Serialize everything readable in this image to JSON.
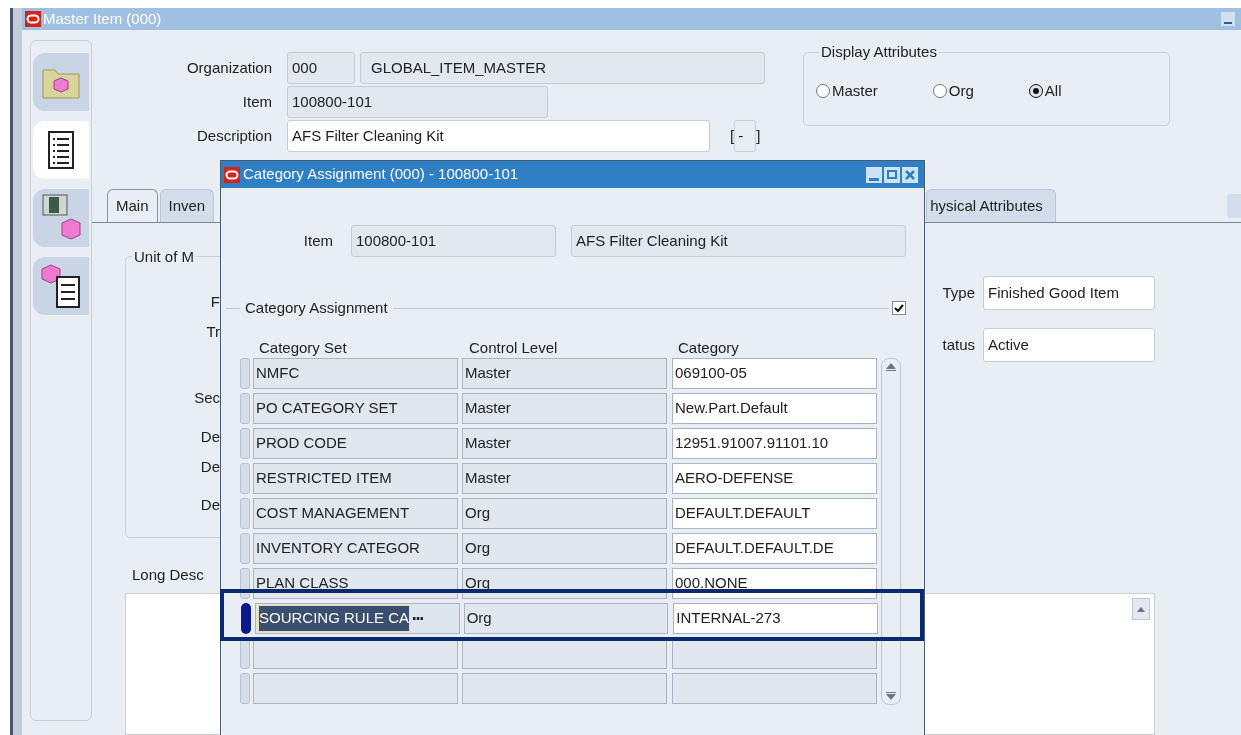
{
  "master_window": {
    "title": "Master Item (000)"
  },
  "header": {
    "organization": {
      "label": "Organization",
      "code": "000",
      "name": "GLOBAL_ITEM_MASTER"
    },
    "item": {
      "label": "Item",
      "value": "100800-101"
    },
    "description": {
      "label": "Description",
      "value": "AFS Filter Cleaning Kit"
    },
    "flexfield": {
      "open": "[",
      "value": "-",
      "close": "]"
    }
  },
  "display_attributes": {
    "title": "Display Attributes",
    "options": [
      {
        "label": "Master",
        "selected": false
      },
      {
        "label": "Org",
        "selected": false
      },
      {
        "label": "All",
        "selected": true
      }
    ]
  },
  "tabs": [
    {
      "label": "Main",
      "selected": true
    },
    {
      "label": "Inven",
      "selected": false
    },
    {
      "label": "hysical Attributes",
      "selected": false
    }
  ],
  "main_tab": {
    "group_title": "Unit of M",
    "labels": [
      "F",
      "Tr",
      "Sec",
      "De",
      "De",
      "De"
    ],
    "fields": [
      {
        "label": "Type",
        "value": "Finished Good Item"
      },
      {
        "label": "tatus",
        "value": "Active"
      }
    ],
    "long_description_label": "Long Desc"
  },
  "dialog": {
    "title": "Category Assignment (000) - 100800-101",
    "item": {
      "label": "Item",
      "value": "100800-101",
      "description": "AFS Filter Cleaning Kit"
    },
    "group_title": "Category Assignment",
    "group_checked": true,
    "columns": [
      "Category Set",
      "Control Level",
      "Category"
    ],
    "rows": [
      {
        "category_set": "NMFC",
        "control_level": "Master",
        "category": "069100-05",
        "selected": false
      },
      {
        "category_set": "PO CATEGORY SET",
        "control_level": "Master",
        "category": "New.Part.Default",
        "selected": false
      },
      {
        "category_set": "PROD CODE",
        "control_level": "Master",
        "category": "12951.91007.91101.10",
        "selected": false
      },
      {
        "category_set": "RESTRICTED ITEM",
        "control_level": "Master",
        "category": "AERO-DEFENSE",
        "selected": false
      },
      {
        "category_set": "COST MANAGEMENT",
        "control_level": "Org",
        "category": "DEFAULT.DEFAULT",
        "selected": false
      },
      {
        "category_set": "INVENTORY CATEGOR",
        "control_level": "Org",
        "category": "DEFAULT.DEFAULT.DE",
        "selected": false
      },
      {
        "category_set": "PLAN CLASS",
        "control_level": "Org",
        "category": "000.NONE",
        "selected": false
      },
      {
        "category_set": "SOURCING RULE CA",
        "control_level": "Org",
        "category": "INTERNAL-273",
        "selected": true
      }
    ]
  }
}
